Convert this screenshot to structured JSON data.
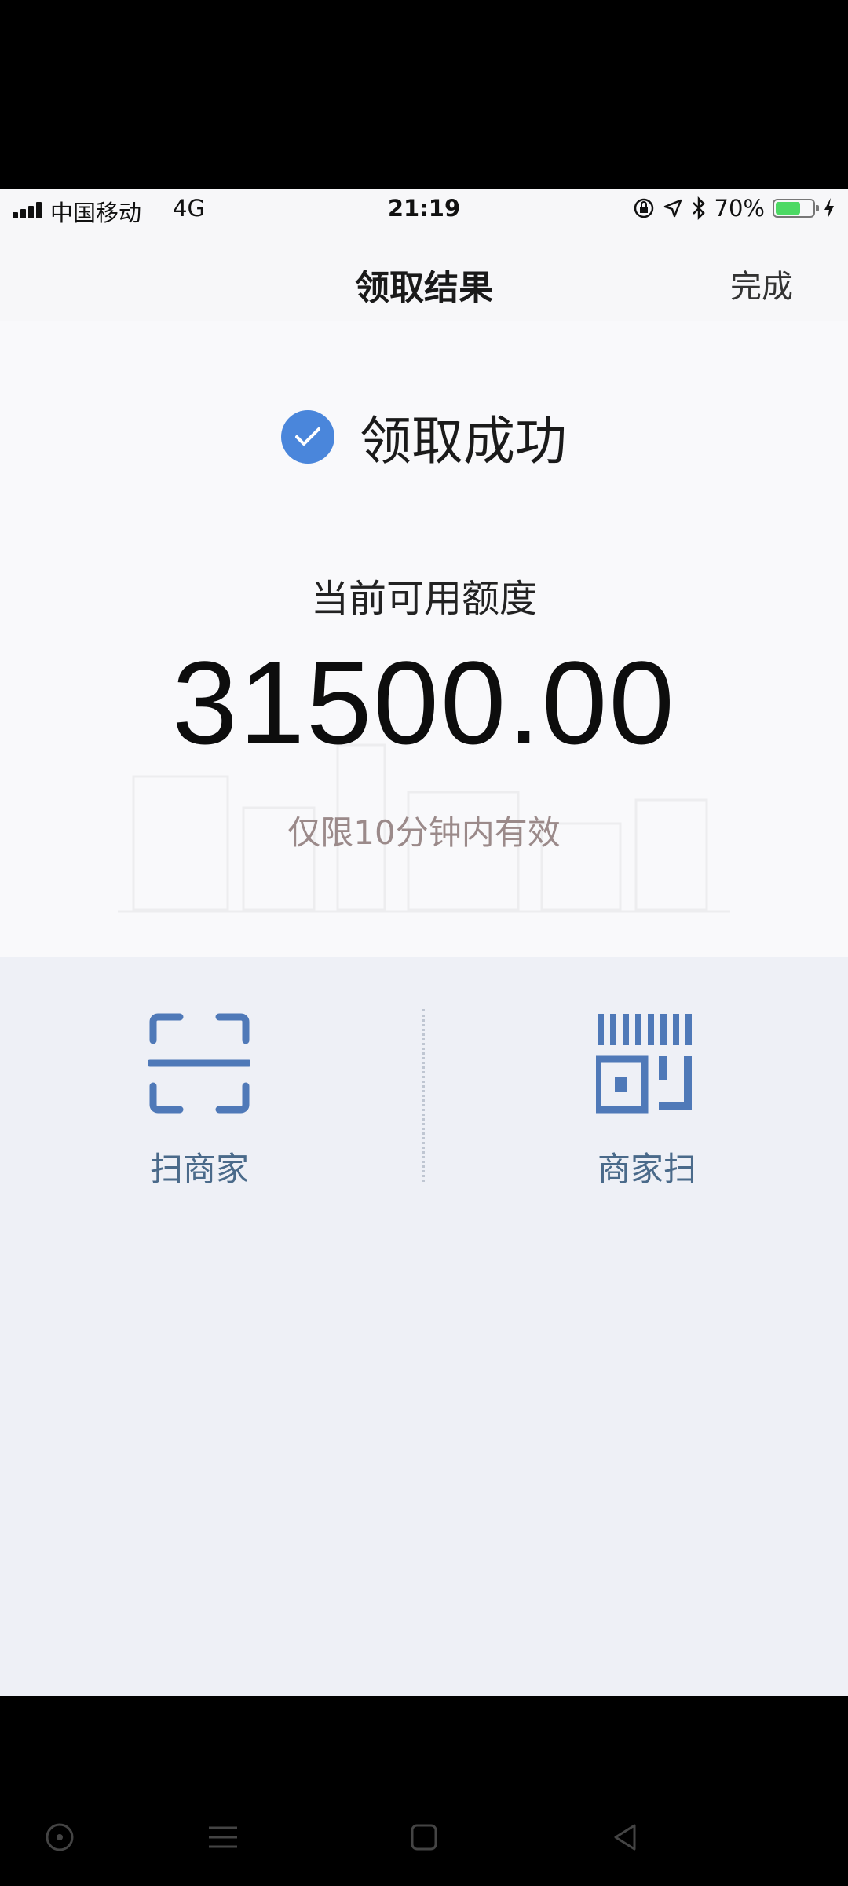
{
  "status_bar": {
    "carrier": "中国移动",
    "network": "4G",
    "time": "21:19",
    "battery": "70%",
    "battery_level": 0.7,
    "icons": [
      "signal-icon",
      "rotation-lock-icon",
      "location-icon",
      "bluetooth-icon",
      "battery-icon",
      "charging-icon"
    ]
  },
  "nav": {
    "title": "领取结果",
    "done": "完成"
  },
  "result": {
    "status": "领取成功",
    "credit_label": "当前可用额度",
    "amount": "31500.00",
    "validity": "仅限10分钟内有效"
  },
  "actions": [
    {
      "label": "扫商家",
      "icon": "scan-frame-icon"
    },
    {
      "label": "商家扫",
      "icon": "barcode-qr-icon"
    }
  ],
  "colors": {
    "accent": "#4a86db",
    "icon_blue": "#4f79b8",
    "validity_text": "#9b8a8a"
  },
  "system_nav": [
    "circle-button-icon",
    "menu-icon",
    "home-square-icon",
    "back-triangle-icon"
  ]
}
